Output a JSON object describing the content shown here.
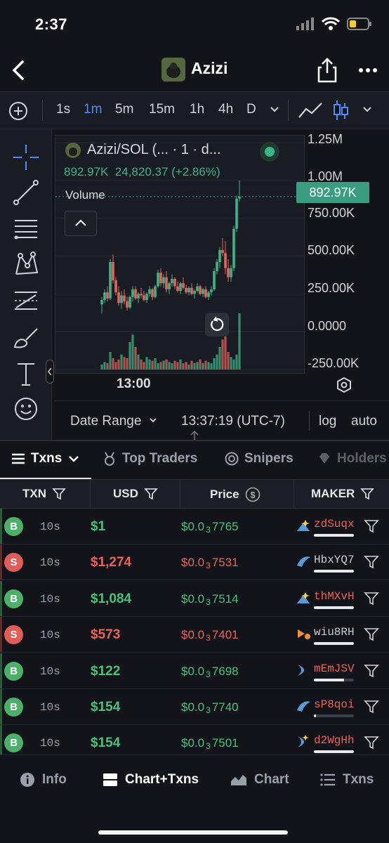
{
  "status": {
    "time": "2:37"
  },
  "header": {
    "title": "Azizi"
  },
  "timeframes": [
    "1s",
    "1m",
    "5m",
    "15m",
    "1h",
    "4h",
    "D"
  ],
  "active_timeframe": "1m",
  "chart_legend": {
    "symbol": "Azizi/SOL (... · 1 · d...",
    "last": "892.97K",
    "change": "24,820.37 (+2.86%)",
    "volume_label": "Volume"
  },
  "price_tag": "892.97K",
  "colors": {
    "up": "#3cb48a",
    "down": "#e8625e",
    "accent": "#4a8cff",
    "price_tag": "#3a9c80"
  },
  "chart_data": {
    "type": "candlestick",
    "y_ticks": [
      "1.25M",
      "1.00M",
      "750.00K",
      "500.00K",
      "250.00K",
      "0.0000",
      "-250.00K"
    ],
    "x_tick": "13:00",
    "ylim": [
      -250000,
      1250000
    ],
    "last_value": 892970,
    "candles": [
      [
        180000,
        230000,
        120000,
        210000
      ],
      [
        210000,
        280000,
        190000,
        260000
      ],
      [
        260000,
        300000,
        200000,
        220000
      ],
      [
        220000,
        480000,
        210000,
        460000
      ],
      [
        460000,
        510000,
        320000,
        340000
      ],
      [
        340000,
        360000,
        240000,
        260000
      ],
      [
        260000,
        300000,
        170000,
        190000
      ],
      [
        190000,
        270000,
        150000,
        240000
      ],
      [
        240000,
        280000,
        180000,
        200000
      ],
      [
        200000,
        230000,
        140000,
        160000
      ],
      [
        160000,
        240000,
        150000,
        230000
      ],
      [
        230000,
        300000,
        200000,
        280000
      ],
      [
        280000,
        300000,
        210000,
        220000
      ],
      [
        220000,
        260000,
        190000,
        250000
      ],
      [
        250000,
        290000,
        220000,
        240000
      ],
      [
        240000,
        270000,
        200000,
        210000
      ],
      [
        210000,
        260000,
        190000,
        250000
      ],
      [
        250000,
        300000,
        230000,
        280000
      ],
      [
        280000,
        290000,
        210000,
        230000
      ],
      [
        230000,
        310000,
        220000,
        300000
      ],
      [
        300000,
        410000,
        290000,
        390000
      ],
      [
        390000,
        420000,
        300000,
        320000
      ],
      [
        320000,
        380000,
        290000,
        360000
      ],
      [
        360000,
        400000,
        260000,
        280000
      ],
      [
        280000,
        330000,
        250000,
        320000
      ],
      [
        320000,
        380000,
        300000,
        350000
      ],
      [
        350000,
        360000,
        280000,
        300000
      ],
      [
        300000,
        330000,
        260000,
        270000
      ],
      [
        270000,
        330000,
        250000,
        320000
      ],
      [
        320000,
        360000,
        280000,
        290000
      ],
      [
        290000,
        310000,
        250000,
        260000
      ],
      [
        260000,
        300000,
        240000,
        290000
      ],
      [
        290000,
        320000,
        240000,
        250000
      ],
      [
        250000,
        280000,
        220000,
        270000
      ],
      [
        270000,
        320000,
        260000,
        300000
      ],
      [
        300000,
        310000,
        240000,
        250000
      ],
      [
        250000,
        290000,
        230000,
        280000
      ],
      [
        280000,
        300000,
        220000,
        230000
      ],
      [
        230000,
        270000,
        210000,
        260000
      ],
      [
        260000,
        300000,
        240000,
        280000
      ],
      [
        280000,
        420000,
        270000,
        400000
      ],
      [
        400000,
        480000,
        380000,
        460000
      ],
      [
        460000,
        560000,
        420000,
        540000
      ],
      [
        540000,
        620000,
        500000,
        520000
      ],
      [
        520000,
        600000,
        380000,
        420000
      ],
      [
        420000,
        480000,
        330000,
        360000
      ],
      [
        360000,
        440000,
        330000,
        420000
      ],
      [
        420000,
        700000,
        400000,
        680000
      ],
      [
        680000,
        900000,
        660000,
        880000
      ],
      [
        880000,
        1000000,
        860000,
        893000
      ]
    ],
    "volumes": [
      4,
      6,
      5,
      14,
      9,
      6,
      8,
      12,
      10,
      9,
      22,
      28,
      18,
      12,
      8,
      6,
      10,
      8,
      7,
      9,
      5,
      6,
      7,
      8,
      6,
      5,
      7,
      6,
      8,
      5,
      6,
      4,
      7,
      5,
      6,
      8,
      5,
      7,
      6,
      5,
      9,
      12,
      18,
      24,
      30,
      14,
      10,
      8,
      12,
      45
    ]
  },
  "footer": {
    "date_range": "Date Range",
    "time": "13:37:19 (UTC-7)",
    "log": "log",
    "auto": "auto"
  },
  "tabs": [
    "Txns",
    "Top Traders",
    "Snipers",
    "Holders"
  ],
  "columns": [
    "TXN",
    "USD",
    "Price",
    "MAKER"
  ],
  "rows": [
    {
      "type": "B",
      "age": "10s",
      "usd": "$1",
      "price_a": "$0.0",
      "price_sub": "3",
      "price_b": "7765",
      "maker": "zdSuqx",
      "bar": 1.0
    },
    {
      "type": "S",
      "age": "10s",
      "usd": "$1,274",
      "price_a": "$0.0",
      "price_sub": "3",
      "price_b": "7531",
      "maker": "HbxYQ7",
      "bar": 1.0
    },
    {
      "type": "B",
      "age": "10s",
      "usd": "$1,084",
      "price_a": "$0.0",
      "price_sub": "3",
      "price_b": "7514",
      "maker": "thMXvH",
      "bar": 1.0
    },
    {
      "type": "S",
      "age": "10s",
      "usd": "$573",
      "price_a": "$0.0",
      "price_sub": "3",
      "price_b": "7401",
      "maker": "wiu8RH",
      "bar": 1.0
    },
    {
      "type": "B",
      "age": "10s",
      "usd": "$122",
      "price_a": "$0.0",
      "price_sub": "3",
      "price_b": "7698",
      "maker": "mEmJSV",
      "bar": 0.75
    },
    {
      "type": "B",
      "age": "10s",
      "usd": "$154",
      "price_a": "$0.0",
      "price_sub": "3",
      "price_b": "7740",
      "maker": "sP8qoi",
      "bar": 0.05
    },
    {
      "type": "B",
      "age": "10s",
      "usd": "$154",
      "price_a": "$0.0",
      "price_sub": "3",
      "price_b": "7501",
      "maker": "d2WgHh",
      "bar": 1.0
    }
  ],
  "nav": [
    "Info",
    "Chart+Txns",
    "Chart",
    "Txns"
  ]
}
